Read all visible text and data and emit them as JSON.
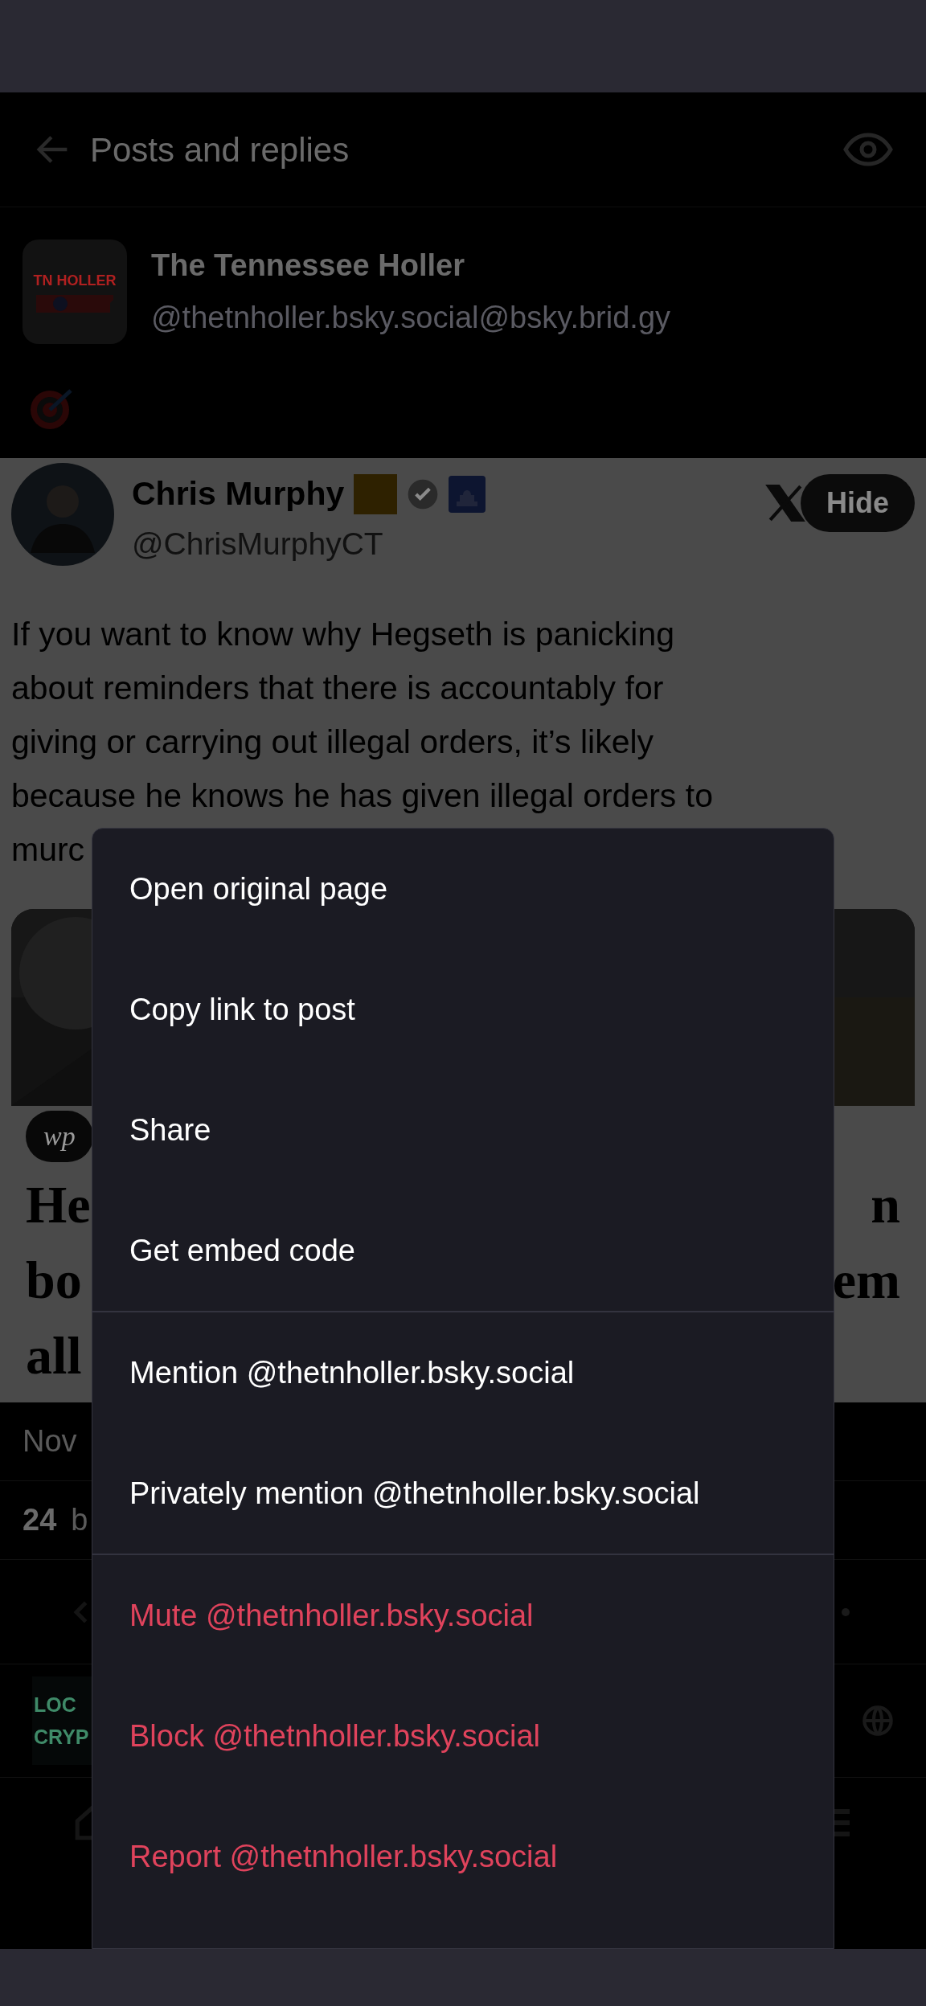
{
  "header": {
    "title": "Posts and replies"
  },
  "profile": {
    "logo_text": "TN HOLLER",
    "name": "The Tennessee Holler",
    "handle": "@thetnholler.bsky.social@bsky.brid.gy"
  },
  "post": {
    "author": "Chris Murphy",
    "handle": "@ChrisMurphyCT",
    "hide_button": "Hide",
    "body_lines": [
      "If you want to know why Hegseth is panicking",
      "about reminders that there is accountably for",
      "giving or carrying out illegal orders, it’s likely",
      "because he knows he has given illegal orders to",
      "murc"
    ],
    "source_badge": "wp",
    "headline_left": [
      "He",
      "bo",
      "all"
    ],
    "headline_right": [
      "n",
      "em"
    ]
  },
  "meta": {
    "date": "Nov",
    "count": "24",
    "count_label": "b"
  },
  "banner": {
    "lines": [
      "LOC",
      "CRYP"
    ]
  },
  "menu": {
    "groups": [
      [
        {
          "label": "Open original page",
          "kind": "normal"
        },
        {
          "label": "Copy link to post",
          "kind": "normal"
        },
        {
          "label": "Share",
          "kind": "normal"
        },
        {
          "label": "Get embed code",
          "kind": "normal"
        }
      ],
      [
        {
          "label": "Mention @thetnholler.bsky.social",
          "kind": "normal"
        },
        {
          "label": "Privately mention @thetnholler.bsky.social",
          "kind": "normal"
        }
      ],
      [
        {
          "label": "Mute @thetnholler.bsky.social",
          "kind": "danger"
        },
        {
          "label": "Block @thetnholler.bsky.social",
          "kind": "danger"
        },
        {
          "label": "Report @thetnholler.bsky.social",
          "kind": "danger"
        }
      ]
    ]
  }
}
